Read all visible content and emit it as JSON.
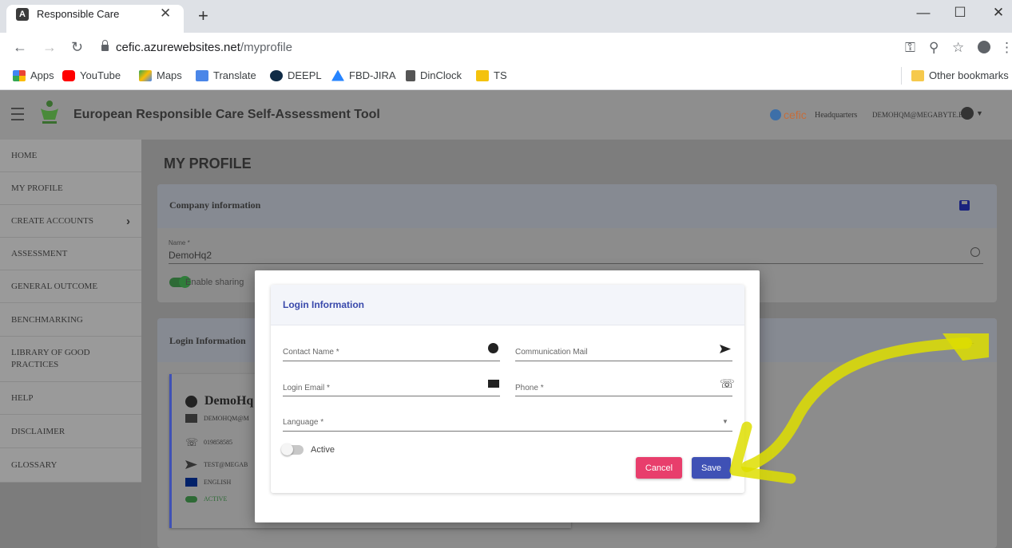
{
  "browser": {
    "tab_title": "Responsible Care",
    "tab_favicon": "A",
    "url_domain": "cefic.azurewebsites.net",
    "url_path": "/myprofile",
    "bookmarks": [
      {
        "label": "Apps",
        "icon": "apps-grid-icon",
        "color": "#4285f4"
      },
      {
        "label": "YouTube",
        "icon": "youtube-icon",
        "color": "#ff0000"
      },
      {
        "label": "Maps",
        "icon": "maps-icon",
        "color": "#34a853"
      },
      {
        "label": "Translate",
        "icon": "translate-icon",
        "color": "#4a86e8"
      },
      {
        "label": "DEEPL",
        "icon": "deepl-icon",
        "color": "#0f2b46"
      },
      {
        "label": "FBD-JIRA",
        "icon": "jira-icon",
        "color": "#2684ff"
      },
      {
        "label": "DinClock",
        "icon": "dinclock-icon",
        "color": "#555555"
      },
      {
        "label": "TS",
        "icon": "ts-icon",
        "color": "#f4c20d"
      }
    ],
    "other_bookmarks": "Other bookmarks"
  },
  "header": {
    "app_title": "European Responsible Care Self-Assessment Tool",
    "brand": "cefic",
    "organisation": "Headquarters",
    "user_email": "DEMOHQM@MEGABYTE.BE"
  },
  "sidebar": {
    "items": [
      {
        "label": "HOME"
      },
      {
        "label": "MY PROFILE"
      },
      {
        "label": "CREATE ACCOUNTS"
      },
      {
        "label": "ASSESSMENT"
      },
      {
        "label": "GENERAL OUTCOME"
      },
      {
        "label": "BENCHMARKING"
      },
      {
        "label": "LIBRARY OF GOOD PRACTICES"
      },
      {
        "label": "HELP"
      },
      {
        "label": "DISCLAIMER"
      },
      {
        "label": "GLOSSARY"
      }
    ]
  },
  "main": {
    "page_title": "MY PROFILE",
    "company": {
      "title": "Company information",
      "name_label": "Name *",
      "name_value": "DemoHq2",
      "sharing_label": "Enable sharing"
    },
    "login": {
      "title": "Login Information",
      "plus": "+",
      "user_card": {
        "name": "DemoHq",
        "email": "DEMOHQM@M",
        "phone": "019858585",
        "communication": "TEST@MEGAB",
        "language": "ENGLISH",
        "status": "ACTIVE"
      }
    }
  },
  "modal": {
    "title": "Login Information",
    "contact_name_label": "Contact Name *",
    "communication_mail_label": "Communication Mail",
    "login_email_label": "Login Email *",
    "phone_label": "Phone *",
    "language_label": "Language *",
    "active_label": "Active",
    "cancel_label": "Cancel",
    "save_label": "Save"
  },
  "colors": {
    "primary": "#3f51b5",
    "cancel": "#e83e6c",
    "toggle_on": "#2f7d3a",
    "annotation_arrow": "#e6e600"
  }
}
